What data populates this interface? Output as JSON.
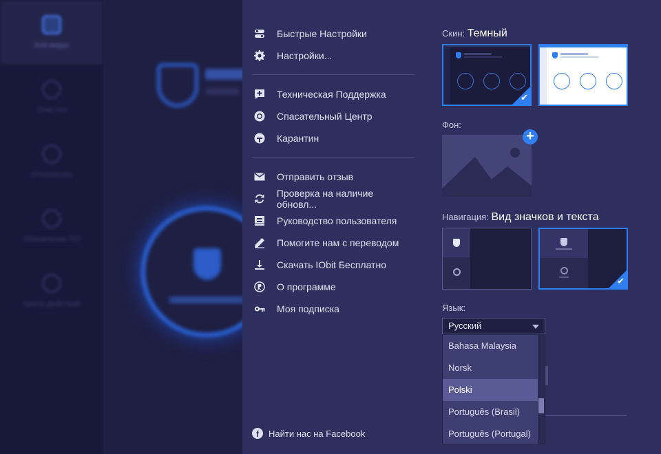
{
  "background": {
    "nav": [
      "Anti-вирус",
      "Очистка",
      "Отношения",
      "Обновление ПО",
      "Центр Действий"
    ]
  },
  "menu": {
    "items": [
      {
        "label": "Быстрые Настройки",
        "icon": "toggle-icon"
      },
      {
        "label": "Настройки...",
        "icon": "gear-icon"
      },
      {
        "label": "Техническая Поддержка",
        "icon": "support-plus-icon"
      },
      {
        "label": "Спасательный Центр",
        "icon": "lifebuoy-icon"
      },
      {
        "label": "Карантин",
        "icon": "quarantine-icon"
      },
      {
        "label": "Отправить отзыв",
        "icon": "envelope-icon"
      },
      {
        "label": "Проверка на наличие обновл...",
        "icon": "refresh-icon"
      },
      {
        "label": "Руководство пользователя",
        "icon": "manual-icon"
      },
      {
        "label": "Помогите нам с переводом",
        "icon": "pencil-icon"
      },
      {
        "label": "Скачать IObit Бесплатно",
        "icon": "download-icon"
      },
      {
        "label": "О программе",
        "icon": "registered-icon"
      },
      {
        "label": "Моя подписка",
        "icon": "key-icon"
      }
    ],
    "facebook": "Найти нас на Facebook"
  },
  "settings": {
    "skin_label": "Скин:",
    "skin_value": "Темный",
    "bg_label": "Фон:",
    "nav_label": "Навигация:",
    "nav_value": "Вид значков и текста",
    "lang_label": "Язык:",
    "lang_selected": "Русский",
    "lang_options": [
      "Bahasa Malaysia",
      "Norsk",
      "Polski",
      "Português (Brasil)",
      "Português (Portugal)"
    ],
    "lang_highlight_index": 2
  },
  "colors": {
    "panel": "#2e2f5e",
    "accent": "#2f7ff3",
    "text": "#dfe1f2"
  }
}
